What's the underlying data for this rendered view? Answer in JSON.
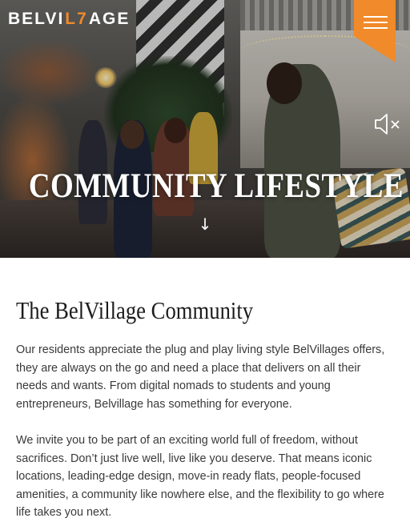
{
  "brand": {
    "logo_before": "BELVI",
    "logo_mark": "L7",
    "logo_after": "AGE",
    "accent_color": "#f08a2a"
  },
  "header": {
    "menu_icon": "hamburger-menu-icon"
  },
  "hero": {
    "title": "COMMUNITY LIFESTYLE",
    "scroll_arrow": "↓",
    "mute_icon": "speaker-muted-icon"
  },
  "main": {
    "heading": "The BelVillage Community",
    "paragraphs": [
      "Our residents appreciate the plug and play living style BelVillages offers, they are always on the go and need a place that delivers on all their needs and wants. From digital nomads to students and young entrepreneurs, Belvillage has something for everyone.",
      "We invite you to be part of an exciting world full of freedom, without sacrifices. Don’t just live well, live like you deserve. That means iconic locations, leading-edge design, move-in ready flats, people-focused amenities, a community like nowhere else, and the flexibility to go where life takes you next."
    ]
  }
}
